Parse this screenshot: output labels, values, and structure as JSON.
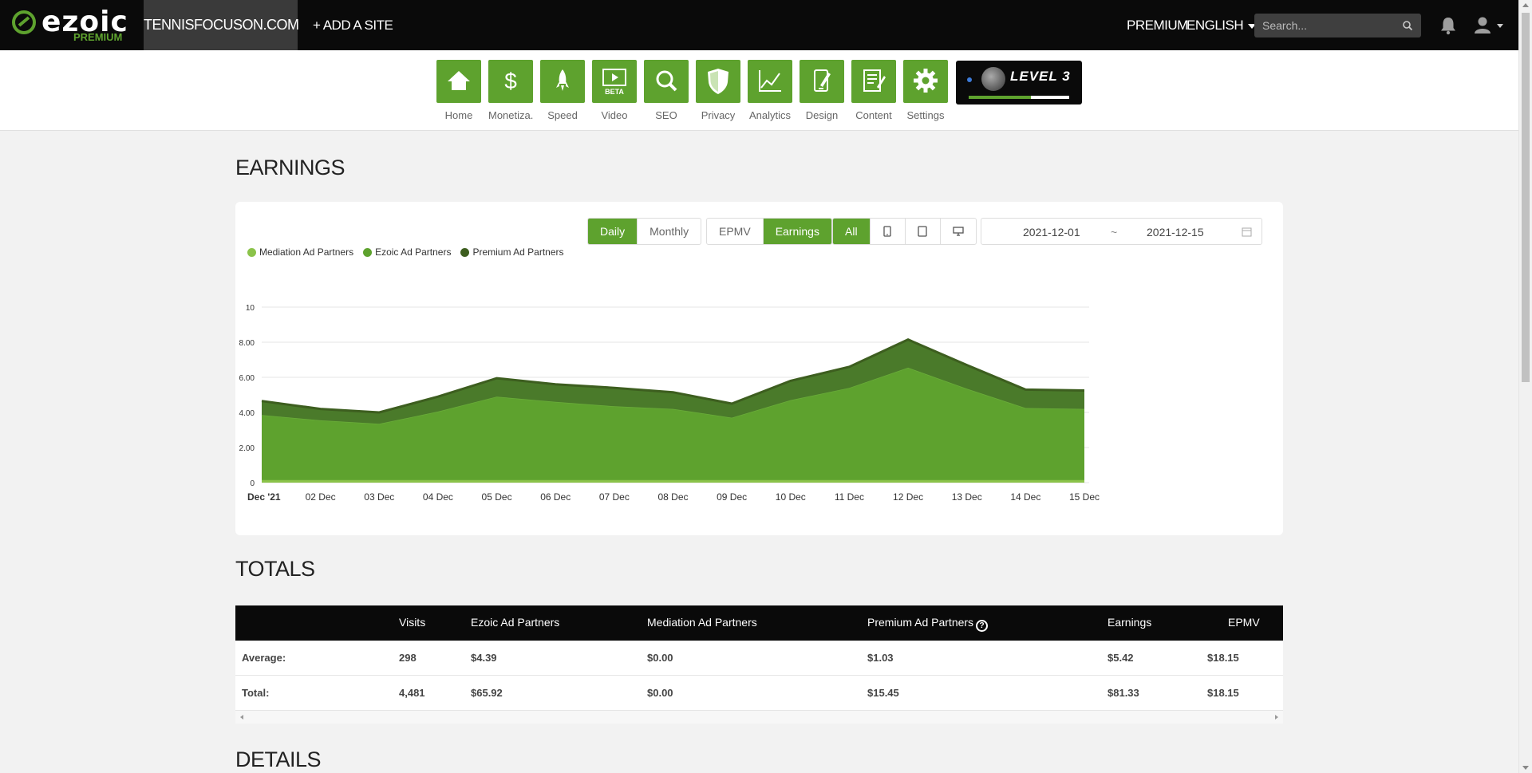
{
  "brand": {
    "name": "ezoic",
    "tier": "PREMIUM",
    "accent": "#5ea22e",
    "dark_green": "#3d5e1f"
  },
  "topbar": {
    "site": "TENNISFOCUSON.COM",
    "add_site": "+ ADD A SITE",
    "premium": "PREMIUM",
    "language": "ENGLISH",
    "search_placeholder": "Search..."
  },
  "nav": [
    {
      "label": "Home",
      "icon": "home-icon"
    },
    {
      "label": "Monetiza...",
      "icon": "dollar-icon"
    },
    {
      "label": "Speed",
      "icon": "rocket-icon"
    },
    {
      "label": "Video",
      "icon": "video-icon",
      "badge": "BETA"
    },
    {
      "label": "SEO",
      "icon": "magnifier-icon"
    },
    {
      "label": "Privacy",
      "icon": "shield-icon"
    },
    {
      "label": "Analytics",
      "icon": "line-chart-icon"
    },
    {
      "label": "Design",
      "icon": "design-icon"
    },
    {
      "label": "Content",
      "icon": "content-icon"
    },
    {
      "label": "Settings",
      "icon": "gear-icon"
    }
  ],
  "level": {
    "text": "LEVEL 3",
    "progress": 0.62
  },
  "earnings": {
    "title": "EARNINGS",
    "period_buttons": [
      "Daily",
      "Monthly"
    ],
    "metric_buttons": [
      "EPMV",
      "Earnings"
    ],
    "device_all": "All",
    "date_start": "2021-12-01",
    "date_sep": "~",
    "date_end": "2021-12-15"
  },
  "chart_data": {
    "type": "area",
    "stacked": true,
    "categories": [
      "Dec '21",
      "02 Dec",
      "03 Dec",
      "04 Dec",
      "05 Dec",
      "06 Dec",
      "07 Dec",
      "08 Dec",
      "09 Dec",
      "10 Dec",
      "11 Dec",
      "12 Dec",
      "13 Dec",
      "14 Dec",
      "15 Dec"
    ],
    "yticks": [
      "0",
      "2.00",
      "4.00",
      "6.00",
      "8.00",
      "10"
    ],
    "ylim": [
      0,
      10
    ],
    "grid": true,
    "legend_position": "top-left",
    "series": [
      {
        "name": "Mediation Ad Partners",
        "color": "#8bc34a",
        "values": [
          0.15,
          0.15,
          0.15,
          0.15,
          0.15,
          0.15,
          0.15,
          0.15,
          0.15,
          0.15,
          0.15,
          0.15,
          0.15,
          0.15,
          0.15
        ]
      },
      {
        "name": "Ezoic Ad Partners",
        "color": "#5ea22e",
        "values": [
          3.7,
          3.4,
          3.2,
          3.9,
          4.75,
          4.45,
          4.2,
          4.05,
          3.55,
          4.55,
          5.25,
          6.4,
          5.2,
          4.1,
          4.05
        ]
      },
      {
        "name": "Premium Ad Partners",
        "color": "#3d6b1f",
        "values": [
          0.8,
          0.65,
          0.65,
          0.85,
          1.05,
          1.0,
          1.05,
          0.95,
          0.8,
          1.1,
          1.2,
          1.6,
          1.35,
          1.05,
          1.05
        ]
      }
    ]
  },
  "totals": {
    "title": "TOTALS",
    "headers": [
      "",
      "Visits",
      "Ezoic Ad Partners",
      "Mediation Ad Partners",
      "Premium Ad Partners",
      "Earnings",
      "EPMV"
    ],
    "rows": [
      [
        "Average:",
        "298",
        "$4.39",
        "$0.00",
        "$1.03",
        "$5.42",
        "$18.15"
      ],
      [
        "Total:",
        "4,481",
        "$65.92",
        "$0.00",
        "$15.45",
        "$81.33",
        "$18.15"
      ]
    ]
  },
  "details": {
    "title": "DETAILS"
  }
}
